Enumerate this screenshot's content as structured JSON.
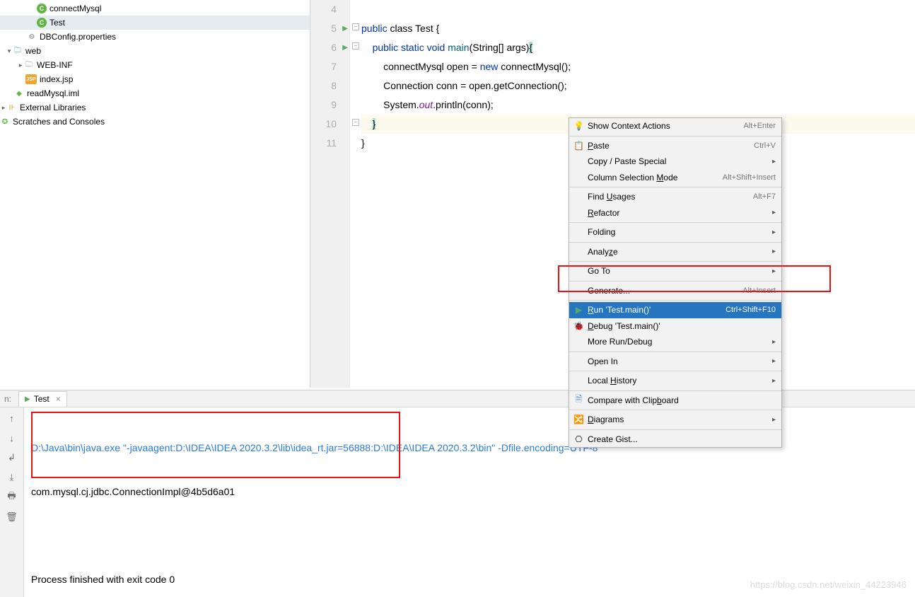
{
  "tree": {
    "connectMysql": "connectMysql",
    "test": "Test",
    "dbconfig": "DBConfig.properties",
    "web": "web",
    "webinf": "WEB-INF",
    "indexjsp": "index.jsp",
    "readmysql": "readMysql.iml",
    "extlib": "External Libraries",
    "scratch": "Scratches and Consoles"
  },
  "gutter": {
    "l4": "4",
    "l5": "5",
    "l6": "6",
    "l7": "7",
    "l8": "8",
    "l9": "9",
    "l10": "10",
    "l11": "11"
  },
  "code": {
    "l5a": "public",
    "l5b": " class ",
    "l5c": "Test",
    " l5d": " {",
    "l6a": "public",
    "l6b": " static ",
    "l6c": "void ",
    "l6d": "main",
    "l6e": "(String[] args)",
    "l6f": "{",
    "l7": "        connectMysql open = ",
    "l7b": "new ",
    "l7c": "connectMysql();",
    "l8": "        Connection conn = open.getConnection();",
    "l9a": "        System.",
    "l9b": "out",
    "l9c": ".println(conn);",
    "l10": "    ",
    "l10b": "}",
    "l11": "}"
  },
  "menu": {
    "showContext": "Show Context Actions",
    "showContextSc": "Alt+Enter",
    "paste": "aste",
    "pasteSc": "Ctrl+V",
    "copyPaste": "Copy / Paste Special",
    "colSel": "Column Selection ",
    "colSel2": "ode",
    "colSelSc": "Alt+Shift+Insert",
    "findUsages": "Find ",
    "findUsages2": "sages",
    "findUsagesSc": "Alt+F7",
    "refactor": "efactor",
    "folding": "Folding",
    "analyze": "Analy",
    "analyze2": "e",
    "goto": "Go To",
    "generate": "Generate...",
    "generateSc": "Alt+Insert",
    "run": "un 'Test.main()'",
    "runSc": "Ctrl+Shift+F10",
    "debug": "ebug 'Test.main()'",
    "moreRun": "More Run/Debug",
    "openIn": "Open In",
    "localHist": "Local ",
    "localHist2": "istory",
    "compareClip": "Compare with Clip",
    "compareClip2": "oard",
    "diagrams": "iagrams",
    "createGist": "Create Gist..."
  },
  "run": {
    "tab": "Test",
    "line1": "D:\\Java\\bin\\java.exe \"-javaagent:D:\\IDEA\\IDEA 2020.3.2\\lib\\idea_rt.jar=56888:D:\\IDEA\\IDEA 2020.3.2\\bin\" -Dfile.encoding=UTF-8",
    "line2": "com.mysql.cj.jdbc.ConnectionImpl@4b5d6a01",
    "line3": "Process finished with exit code 0"
  },
  "watermark": "https://blog.csdn.net/weixin_44223946"
}
